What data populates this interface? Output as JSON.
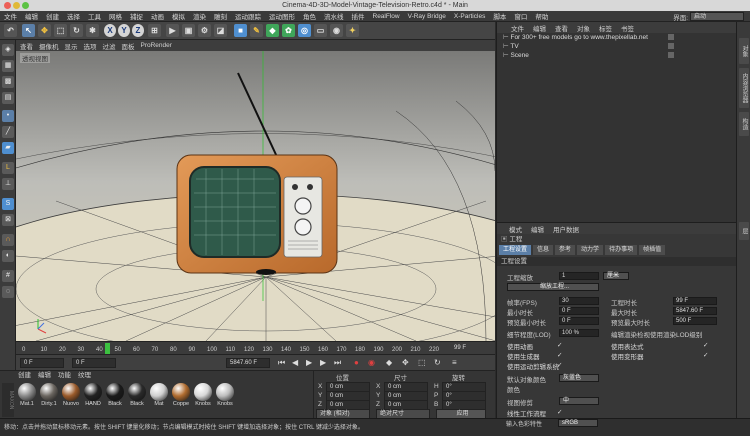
{
  "window": {
    "title": "Cinema-4D-3D-Model-Vintage-Television-Retro.c4d * - Main"
  },
  "menu": [
    "文件",
    "编辑",
    "创建",
    "选择",
    "工具",
    "网格",
    "捕捉",
    "动画",
    "模拟",
    "渲染",
    "雕刻",
    "运动跟踪",
    "运动图形",
    "角色",
    "流水线",
    "插件",
    "RealFlow",
    "V-Ray Bridge",
    "X-Particles",
    "脚本",
    "窗口",
    "帮助"
  ],
  "layout": {
    "label": "界面:",
    "value": "启动"
  },
  "toolbar": {
    "undo_icon": "undo-icon",
    "axes": [
      "X",
      "Y",
      "Z"
    ]
  },
  "viewport": {
    "menu": [
      "查看",
      "摄像机",
      "显示",
      "选项",
      "过滤",
      "面板",
      "ProRender"
    ],
    "label": "透视视图"
  },
  "timeline": {
    "ticks": [
      "0",
      "10",
      "20",
      "30",
      "40",
      "50",
      "60",
      "70",
      "80",
      "90",
      "100",
      "110",
      "120",
      "130",
      "140",
      "150",
      "160",
      "170",
      "180",
      "190",
      "200",
      "210",
      "220",
      "230"
    ],
    "current": "99",
    "end_label": "99 F"
  },
  "transport": {
    "start": "0 F",
    "min": "0 F",
    "max": "5847.60 F",
    "end": "5847.60 F"
  },
  "materials": {
    "menu": [
      "创建",
      "编辑",
      "功能",
      "纹理"
    ],
    "items": [
      {
        "name": "Mat.1",
        "color": "#8a8a8a"
      },
      {
        "name": "Dirty.1",
        "color": "#6b6660"
      },
      {
        "name": "Nuovo",
        "color": "#9a5a2a"
      },
      {
        "name": "HAND",
        "color": "#222222"
      },
      {
        "name": "Black",
        "color": "#1a1a1a"
      },
      {
        "name": "Black",
        "color": "#2a2a2a"
      },
      {
        "name": "Mat",
        "color": "#cfcfcf"
      },
      {
        "name": "Coppe",
        "color": "#b06c2f"
      },
      {
        "name": "Knobs",
        "color": "#d8d8d8"
      },
      {
        "name": "Knobs",
        "color": "#bdbdbd"
      }
    ]
  },
  "coords": {
    "headers": [
      "位置",
      "尺寸",
      "旋转"
    ],
    "rows": [
      {
        "axis": "X",
        "pos": "0 cm",
        "axis2": "X",
        "size": "0 cm",
        "rot_axis": "H",
        "rot": "0°"
      },
      {
        "axis": "Y",
        "pos": "0 cm",
        "axis2": "Y",
        "size": "0 cm",
        "rot_axis": "P",
        "rot": "0°"
      },
      {
        "axis": "Z",
        "pos": "0 cm",
        "axis2": "Z",
        "size": "0 cm",
        "rot_axis": "B",
        "rot": "0°"
      }
    ],
    "mode": "对象 (相对)",
    "size_mode": "绝对尺寸",
    "apply": "应用"
  },
  "status": "移动：点击并拖动鼠标移动元素。按住 SHIFT 键量化移动；节点编辑模式时按住 SHIFT 键增加选择对象；按住 CTRL 键减少选择对象。",
  "objects": {
    "menu": [
      "文件",
      "编辑",
      "查看",
      "对象",
      "标签",
      "书签"
    ],
    "rows": [
      "For 300+ free models go to www.thepixellab.net",
      "TV",
      "Scene"
    ]
  },
  "sidetabs": [
    "对象",
    "内容浏览器",
    "构造",
    "层"
  ],
  "attributes": {
    "menu": [
      "模式",
      "编辑",
      "用户数据"
    ],
    "title": "工程",
    "tabs": [
      "工程设置",
      "信息",
      "参考",
      "动力学",
      "待办事项",
      "帧插值"
    ],
    "section": "工程设置",
    "scale_label": "工程缩放",
    "scale_value": "1",
    "scale_unit": "厘米",
    "scale_button": "缩放工程...",
    "fps_label": "帧率(FPS)",
    "fps": "30",
    "duration_label": "工程时长",
    "duration": "99 F",
    "min_time_label": "最小时长",
    "min_time": "0 F",
    "max_time_label": "最大时长",
    "max_time": "5847.60 F",
    "prev_min_label": "预览最小时长",
    "prev_min": "0 F",
    "prev_max_label": "预览最大时长",
    "prev_max": "500 F",
    "lod_label": "细节程度(LOD)",
    "lod": "100 %",
    "lod_render_label": "编辑渲染检视使用渲染LOD级别",
    "anim_label": "使用动画",
    "expr_label": "使用表达式",
    "gen_label": "使用生成器",
    "deform_label": "使用变形器",
    "motion_label": "使用运动剪辑系统",
    "color_label": "默认对象颜色",
    "color_value": "灰蓝色",
    "color2_label": "颜色",
    "clip_label": "视图修剪",
    "clip_value": "中",
    "linear_label": "线性工作流程",
    "input_label": "输入色彩特性",
    "input_value": "sRGB"
  }
}
